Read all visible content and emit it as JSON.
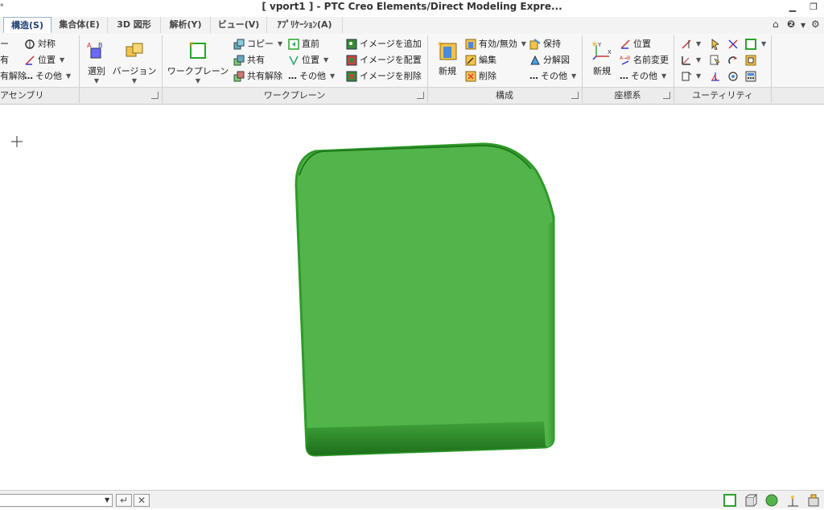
{
  "window": {
    "title": "[ vport1 ] - PTC Creo Elements/Direct Modeling Expre..."
  },
  "qat": {
    "glyph": "ᐤ"
  },
  "tabs": [
    {
      "label": "構造(S)",
      "active": true
    },
    {
      "label": "集合体(E)"
    },
    {
      "label": "3D 図形"
    },
    {
      "label": "解析(Y)"
    },
    {
      "label": "ビュー(V)"
    },
    {
      "label": "ｱﾌﾟﾘｹｰｼｮﾝ(A)"
    }
  ],
  "ribbon": {
    "assembly": {
      "label": "アセンブリ",
      "items": [
        "ー",
        "有",
        "有解除"
      ],
      "items2": [
        "対称",
        "位置",
        "その他"
      ]
    },
    "select": {
      "label": "選別"
    },
    "version": {
      "label": "バージョン"
    },
    "workplane": {
      "label": "ワークプレーン",
      "big": "ワークプレーン",
      "items": [
        "コピー",
        "共有",
        "共有解除"
      ],
      "items2": [
        "直前",
        "位置",
        "その他"
      ],
      "images": [
        "イメージを追加",
        "イメージを配置",
        "イメージを削除"
      ]
    },
    "structure": {
      "label": "構成",
      "big": "新規",
      "items": [
        "有効/無効",
        "編集",
        "削除"
      ],
      "items2": [
        "保持",
        "分解図",
        "その他"
      ]
    },
    "coords": {
      "label": "座標系",
      "big": "新規",
      "items": [
        "位置",
        "名前変更",
        "その他"
      ]
    },
    "utility": {
      "label": "ユーティリティ"
    }
  },
  "colors": {
    "part_fill": "#52b54b",
    "part_edge": "#2f9a2a",
    "part_dark": "#1f7a1c",
    "accent": "#1f3f73"
  },
  "status": {
    "input_value": ""
  }
}
